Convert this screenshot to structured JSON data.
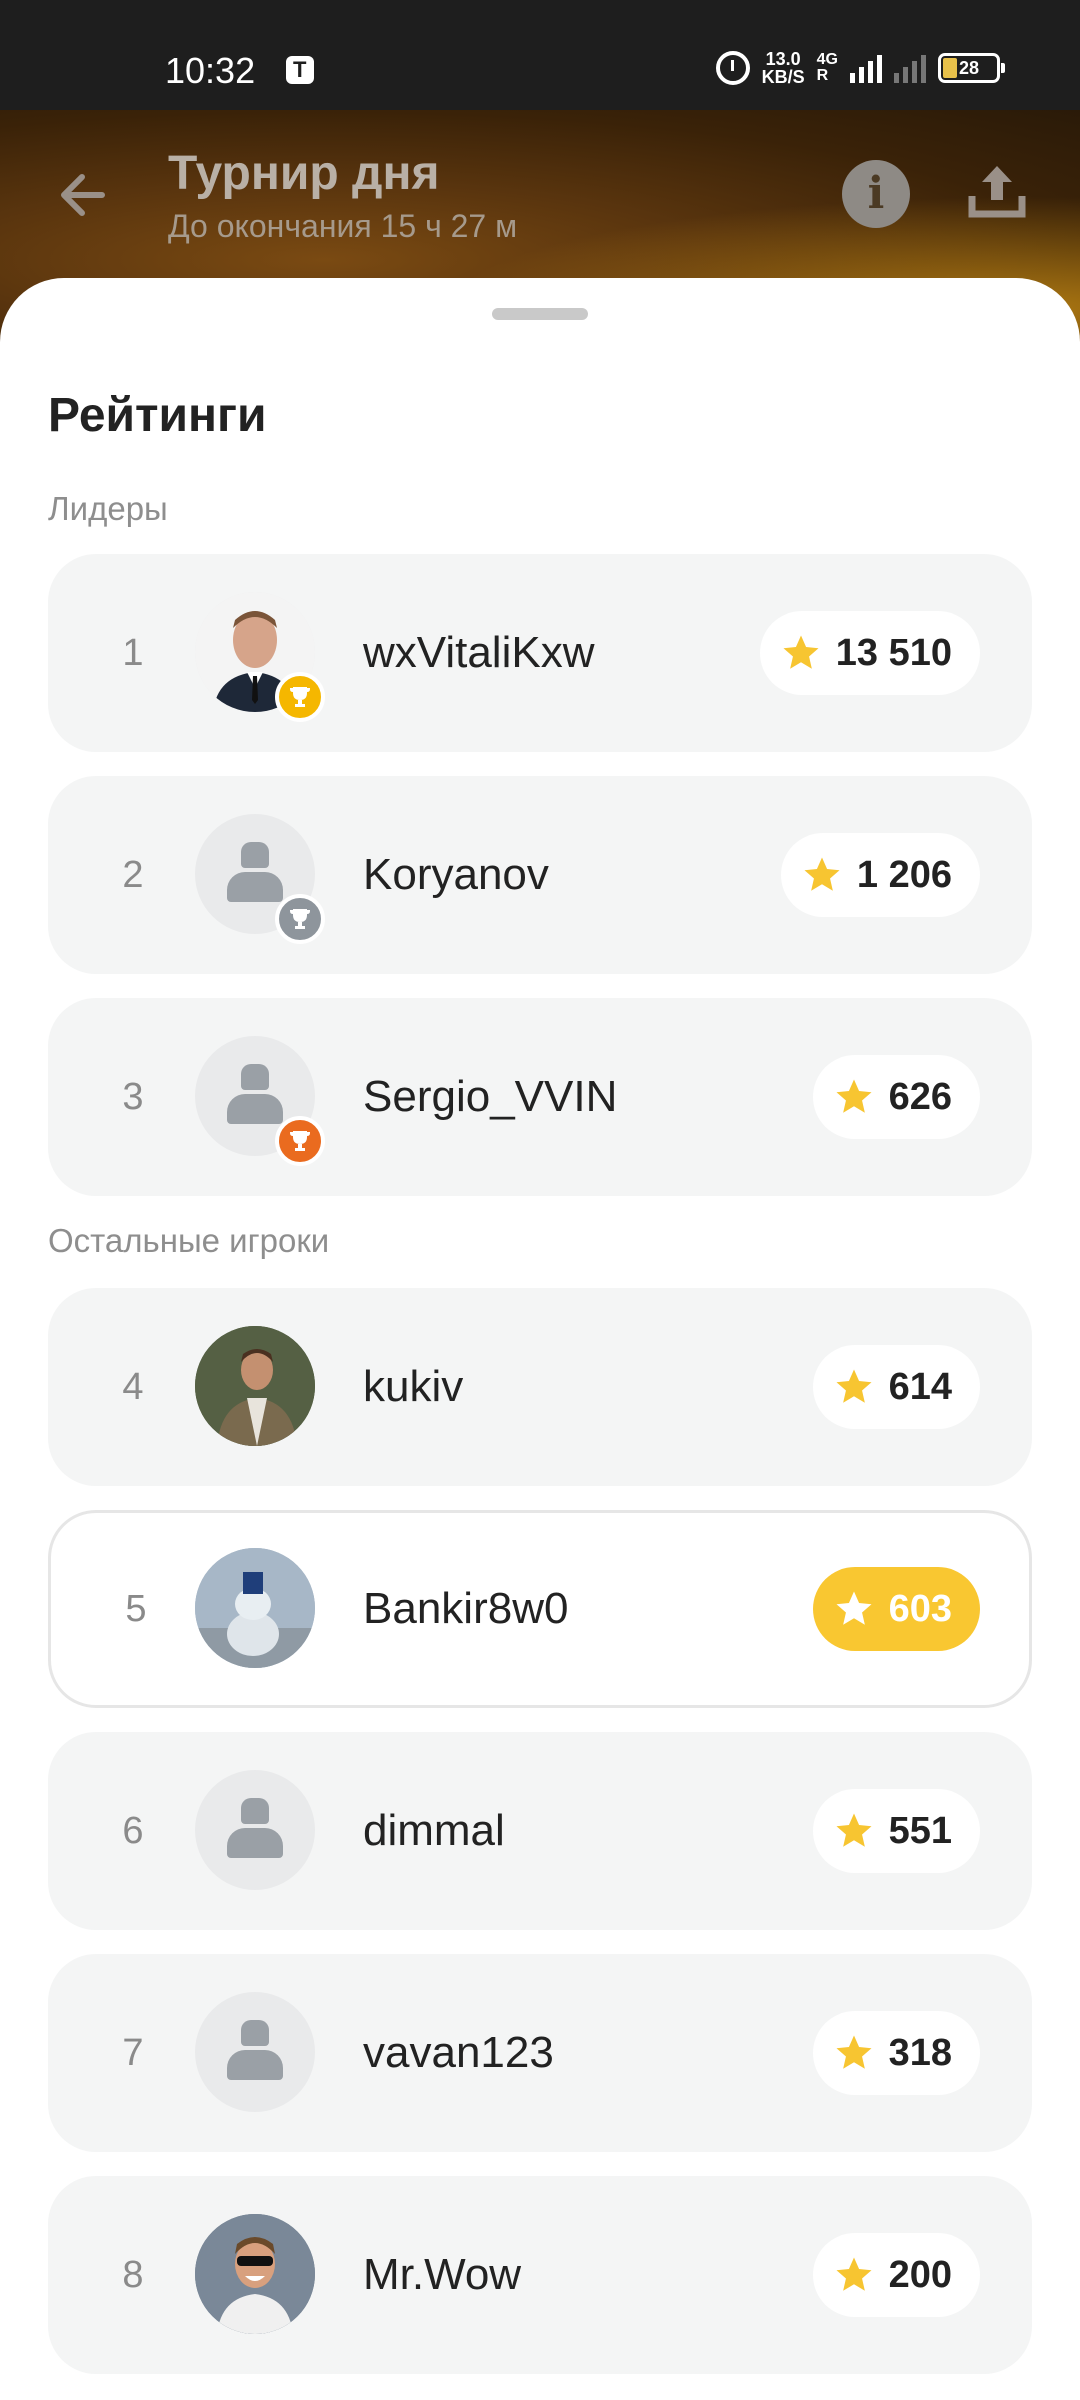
{
  "status_bar": {
    "time": "10:32",
    "speed_top": "13.0",
    "speed_bottom": "KB/S",
    "network_top": "4G",
    "network_bottom": "R",
    "battery": "28"
  },
  "header": {
    "title": "Турнир дня",
    "subtitle": "До окончания 15 ч 27 м"
  },
  "sheet": {
    "title": "Рейтинги",
    "leaders_label": "Лидеры",
    "others_label": "Остальные игроки"
  },
  "leaders": [
    {
      "rank": "1",
      "name": "wxVitaliKxw",
      "score": "13 510",
      "trophy": "gold",
      "avatar": "photo-man-suit"
    },
    {
      "rank": "2",
      "name": "Koryanov",
      "score": "1 206",
      "trophy": "silver",
      "avatar": "default"
    },
    {
      "rank": "3",
      "name": "Sergio_VVIN",
      "score": "626",
      "trophy": "bronze",
      "avatar": "default"
    }
  ],
  "others": [
    {
      "rank": "4",
      "name": "kukiv",
      "score": "614",
      "avatar": "photo-man-jacket"
    },
    {
      "rank": "5",
      "name": "Bankir8w0",
      "score": "603",
      "avatar": "photo-snowman",
      "current_user": true
    },
    {
      "rank": "6",
      "name": "dimmal",
      "score": "551",
      "avatar": "default"
    },
    {
      "rank": "7",
      "name": "vavan123",
      "score": "318",
      "avatar": "default"
    },
    {
      "rank": "8",
      "name": "Mr.Wow",
      "score": "200",
      "avatar": "photo-man-sunglasses"
    }
  ],
  "colors": {
    "accent": "#f9c731",
    "gold": "#f5b700",
    "silver": "#8e959c",
    "bronze": "#ea6b1f",
    "row_bg": "#f4f5f5"
  }
}
